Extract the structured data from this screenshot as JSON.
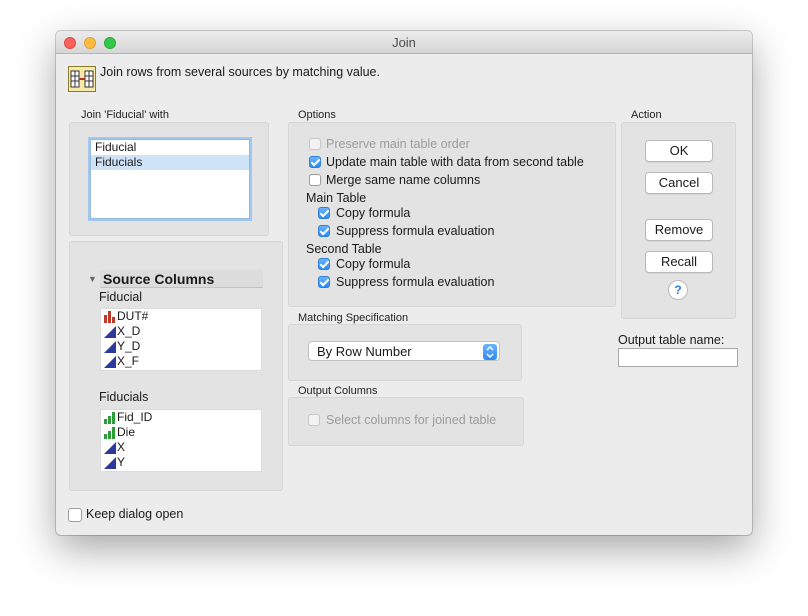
{
  "window": {
    "title": "Join"
  },
  "header": {
    "description": "Join rows from several sources by matching value.",
    "icon": "join-table-icon"
  },
  "join_with": {
    "label": "Join 'Fiducial' with",
    "items": [
      {
        "label": "Fiducial",
        "selected": false
      },
      {
        "label": "Fiducials",
        "selected": true
      }
    ]
  },
  "source_columns": {
    "title": "Source Columns",
    "tables": [
      {
        "name": "Fiducial",
        "columns": [
          {
            "label": "DUT#",
            "icon": "nominal-bar-icon"
          },
          {
            "label": "X_D",
            "icon": "continuous-ramp-icon"
          },
          {
            "label": "Y_D",
            "icon": "continuous-ramp-icon"
          },
          {
            "label": "X_F",
            "icon": "continuous-ramp-icon"
          }
        ]
      },
      {
        "name": "Fiducials",
        "columns": [
          {
            "label": "Fid_ID",
            "icon": "ordinal-bar-icon"
          },
          {
            "label": "Die",
            "icon": "ordinal-bar-icon"
          },
          {
            "label": "X",
            "icon": "continuous-ramp-icon"
          },
          {
            "label": "Y",
            "icon": "continuous-ramp-icon"
          }
        ]
      }
    ]
  },
  "options": {
    "label": "Options",
    "preserve_order": {
      "label": "Preserve main table order",
      "checked": false,
      "disabled": true
    },
    "update_main": {
      "label": "Update main table with data from second table",
      "checked": true
    },
    "merge_same": {
      "label": "Merge same name columns",
      "checked": false
    },
    "main_table": {
      "heading": "Main Table",
      "copy_formula": {
        "label": "Copy formula",
        "checked": true
      },
      "suppress_eval": {
        "label": "Suppress formula evaluation",
        "checked": true
      }
    },
    "second_table": {
      "heading": "Second Table",
      "copy_formula": {
        "label": "Copy formula",
        "checked": true
      },
      "suppress_eval": {
        "label": "Suppress formula evaluation",
        "checked": true
      }
    }
  },
  "matching": {
    "label": "Matching Specification",
    "value": "By Row Number"
  },
  "output_columns": {
    "label": "Output Columns",
    "select_columns": {
      "label": "Select columns for joined table",
      "checked": false,
      "disabled": true
    }
  },
  "action": {
    "label": "Action",
    "ok": "OK",
    "cancel": "Cancel",
    "remove": "Remove",
    "recall": "Recall",
    "help": "?"
  },
  "output_name": {
    "label": "Output table name:",
    "value": ""
  },
  "keep_open": {
    "label": "Keep dialog open",
    "checked": false
  },
  "colors": {
    "accent": "#2a8cf3",
    "selection": "#cfe3f7",
    "nominal": "#c0392b",
    "continuous": "#2b3a9c",
    "ordinal": "#2e9e3a"
  }
}
